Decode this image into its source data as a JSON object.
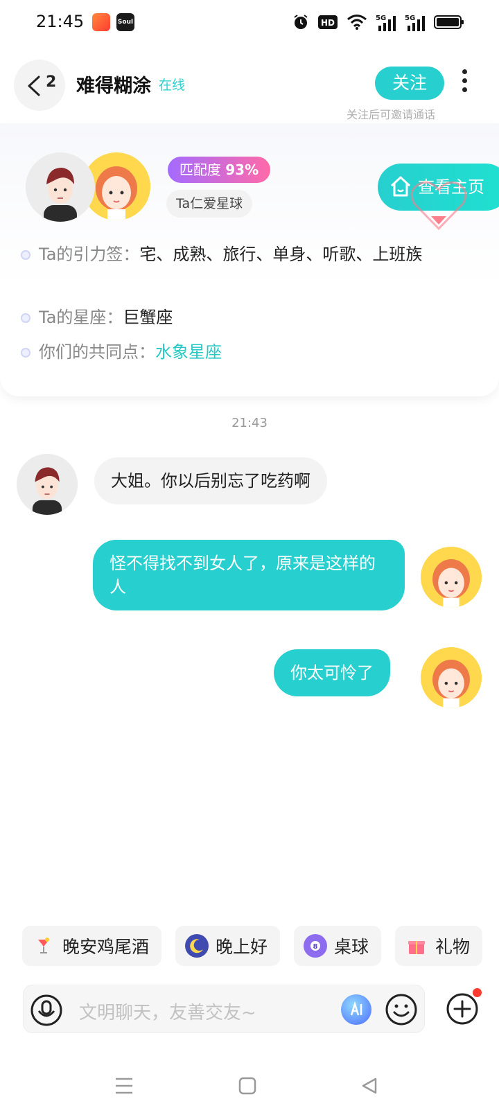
{
  "status_bar": {
    "time": "21:45",
    "app_icon_2_text": "Soul",
    "icons": [
      "alarm-icon",
      "hd-icon",
      "wifi-icon",
      "5g-signal-icon",
      "5g-signal-icon",
      "battery-icon"
    ],
    "hd_text": "HD",
    "sig1_text": "5G",
    "sig2_text": "5G"
  },
  "header": {
    "back_count": "2",
    "name": "难得糊涂",
    "status": "在线",
    "follow_label": "关注",
    "follow_hint": "关注后可邀请通话"
  },
  "profile": {
    "match_label": "匹配度",
    "match_value": "93%",
    "love_tag": "Ta仁爱星球",
    "home_button": "查看主页",
    "tags_label": "Ta的引力签：",
    "tags_value": "宅、成熟、旅行、单身、听歌、上班族",
    "sign_label": "Ta的星座：",
    "sign_value": "巨蟹座",
    "common_label": "你们的共同点：",
    "common_value": "水象星座"
  },
  "chat": {
    "timestamp": "21:43",
    "messages": [
      {
        "from": "other",
        "text": "大姐。你以后别忘了吃药啊"
      },
      {
        "from": "me",
        "text": "怪不得找不到女人了，原来是这样的人"
      },
      {
        "from": "me",
        "text": "你太可怜了"
      }
    ]
  },
  "quick_chips": [
    {
      "icon": "cocktail-icon",
      "label": "晚安鸡尾酒"
    },
    {
      "icon": "moon-icon",
      "label": "晚上好"
    },
    {
      "icon": "billiard-ball-icon",
      "label": "桌球"
    },
    {
      "icon": "gift-icon",
      "label": "礼物"
    }
  ],
  "input": {
    "placeholder": "文明聊天，友善交友~"
  },
  "colors": {
    "accent": "#27d0cf",
    "match_gradient_start": "#a46bff",
    "match_gradient_end": "#ff6aa8",
    "notification_dot": "#ff3b30"
  }
}
